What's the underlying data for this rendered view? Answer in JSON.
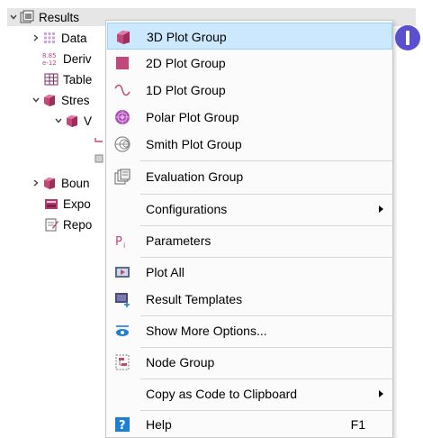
{
  "tree": {
    "root_label": "Results",
    "items": [
      {
        "label": "Data",
        "icon": "datasets-icon"
      },
      {
        "label": "Deriv",
        "icon": "derived-values-icon",
        "icon_text": "8.85 e-12"
      },
      {
        "label": "Table",
        "icon": "table-icon"
      },
      {
        "label": "Stres",
        "icon": "plot-group-3d-icon"
      },
      {
        "label": "V",
        "icon": "volume-plot-icon"
      },
      {
        "label": "Boun",
        "icon": "plot-group-3d-icon"
      },
      {
        "label": "Expo",
        "icon": "export-icon"
      },
      {
        "label": "Repo",
        "icon": "reports-icon"
      }
    ]
  },
  "menu": {
    "items": [
      {
        "label": "3D Plot Group",
        "icon": "plot-group-3d-icon"
      },
      {
        "label": "2D Plot Group",
        "icon": "plot-group-2d-icon"
      },
      {
        "label": "1D Plot Group",
        "icon": "plot-group-1d-icon"
      },
      {
        "label": "Polar Plot Group",
        "icon": "polar-plot-icon"
      },
      {
        "label": "Smith Plot Group",
        "icon": "smith-plot-icon"
      },
      {
        "label": "Evaluation Group",
        "icon": "evaluation-group-icon"
      },
      {
        "label": "Configurations"
      },
      {
        "label": "Parameters",
        "icon": "parameters-icon",
        "icon_text": "P"
      },
      {
        "label": "Plot All",
        "icon": "plot-all-icon"
      },
      {
        "label": "Result Templates",
        "icon": "result-templates-icon"
      },
      {
        "label": "Show More Options...",
        "icon": "show-more-options-icon"
      },
      {
        "label": "Node Group",
        "icon": "node-group-icon"
      },
      {
        "label": "Copy as Code to Clipboard"
      },
      {
        "label": "Help",
        "icon": "help-icon",
        "icon_text": "?",
        "shortcut": "F1"
      }
    ]
  },
  "badge": {
    "color": "#5a4fcf"
  },
  "colors": {
    "highlight_bg": "#cce8ff",
    "highlight_border": "#99d1ff",
    "plot_3d": "#c2477a",
    "plot_2d": "#c2477a",
    "polar": "#b04db5",
    "help": "#1e7fd1"
  }
}
